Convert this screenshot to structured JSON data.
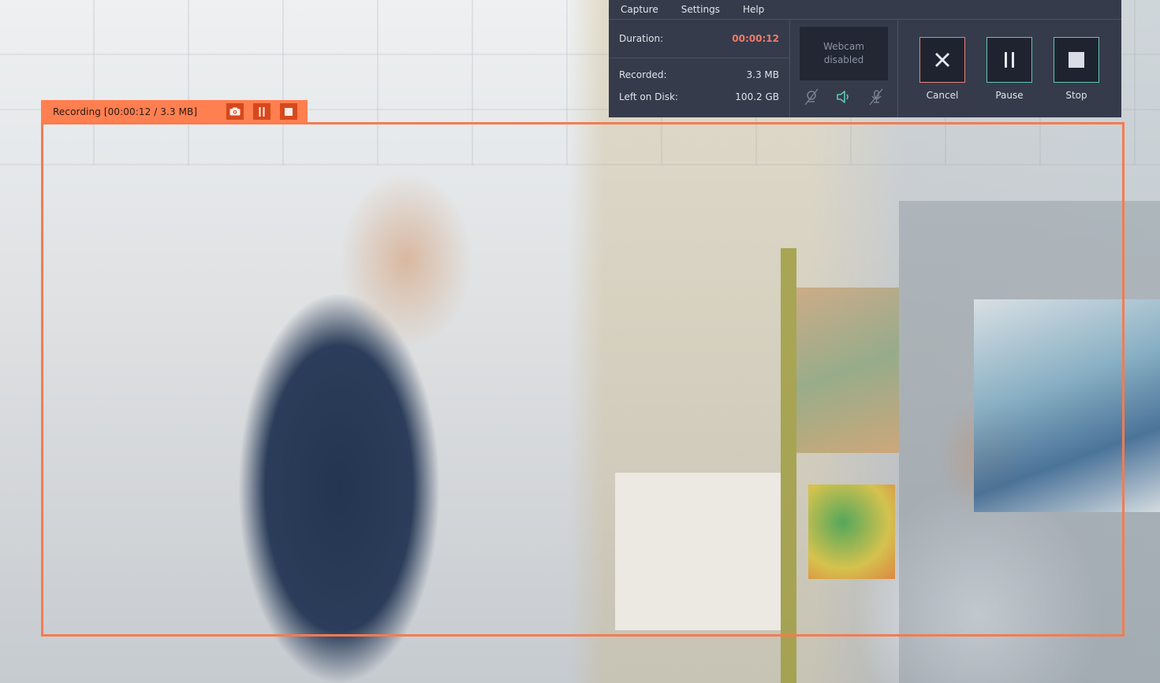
{
  "recording_bar": {
    "label": "Recording [00:00:12 / 3.3 MB]",
    "buttons": [
      {
        "name": "screenshot",
        "icon": "camera-icon"
      },
      {
        "name": "pause",
        "icon": "pause-icon"
      },
      {
        "name": "stop",
        "icon": "stop-icon"
      }
    ]
  },
  "panel": {
    "menu": [
      "Capture",
      "Settings",
      "Help"
    ],
    "stats": {
      "duration_label": "Duration:",
      "duration_value": "00:00:12",
      "recorded_label": "Recorded:",
      "recorded_value": "3.3 MB",
      "disk_label": "Left on Disk:",
      "disk_value": "100.2 GB"
    },
    "webcam": {
      "line1": "Webcam",
      "line2": "disabled"
    },
    "sources": [
      {
        "name": "webcam",
        "icon": "webcam-off-icon",
        "enabled": false
      },
      {
        "name": "system-audio",
        "icon": "speaker-icon",
        "enabled": true
      },
      {
        "name": "microphone",
        "icon": "microphone-off-icon",
        "enabled": false
      }
    ],
    "actions": {
      "cancel": "Cancel",
      "pause": "Pause",
      "stop": "Stop"
    }
  },
  "colors": {
    "accent_orange": "#ff7f50",
    "frame_border": "#f47c52",
    "panel_bg": "#353b4b",
    "duration_red": "#f07b68",
    "enabled_teal": "#5ec8b0"
  }
}
